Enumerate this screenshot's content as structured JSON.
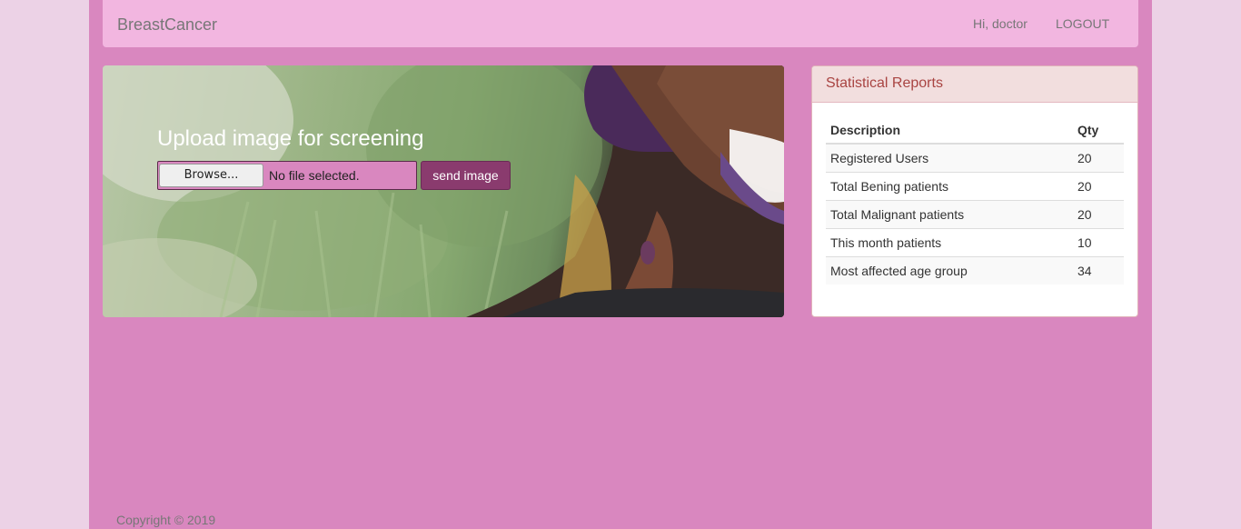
{
  "navbar": {
    "brand": "BreastCancer",
    "greeting": "Hi, doctor",
    "logout": "LOGOUT",
    "background": "#f2b6e0"
  },
  "hero": {
    "title": "Upload image for screening",
    "file_input": {
      "browse_label": "Browse...",
      "status": "No file selected."
    },
    "send_button": "send image"
  },
  "stats_panel": {
    "title": "Statistical Reports",
    "columns": [
      "Description",
      "Qty"
    ],
    "rows": [
      {
        "description": "Registered Users",
        "qty": "20"
      },
      {
        "description": "Total Bening patients",
        "qty": "20"
      },
      {
        "description": "Total Malignant patients",
        "qty": "20"
      },
      {
        "description": "This month patients",
        "qty": "10"
      },
      {
        "description": "Most affected age group",
        "qty": "34"
      }
    ]
  },
  "footer": {
    "copyright": "Copyright © 2019"
  },
  "colors": {
    "page_bg": "#ecd2e6",
    "container_bg": "#d987bf",
    "accent_button": "#8a3b6e",
    "panel_heading_text": "#a94442"
  }
}
